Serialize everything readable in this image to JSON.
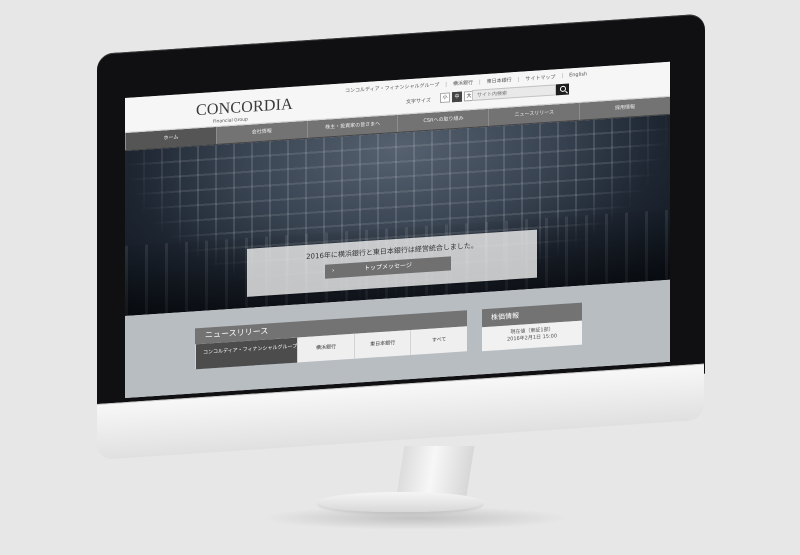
{
  "site": {
    "logo": "CONCORDIA",
    "logo_subtitle": "Financial Group",
    "utility_links": [
      "コンコルディア・フィナンシャルグループ",
      "横浜銀行",
      "東日本銀行",
      "サイトマップ",
      "English"
    ],
    "font_size_label": "文字サイズ",
    "font_sizes": [
      "小",
      "中",
      "大"
    ],
    "search_placeholder": "サイト内検索"
  },
  "navigation": {
    "items": [
      "ホーム",
      "会社情報",
      "株主・投資家の皆さまへ",
      "CSRへの取り組み",
      "ニュースリリース",
      "採用情報"
    ]
  },
  "hero": {
    "message": "2016年に横浜銀行と東日本銀行は経営統合しました。",
    "button_label": "トップメッセージ"
  },
  "news": {
    "title": "ニュースリリース",
    "tabs": [
      "コンコルディア・フィナンシャルグループ",
      "横浜銀行",
      "東日本銀行",
      "すべて"
    ]
  },
  "stock": {
    "title": "株価情報",
    "line1": "現在値（東証1部）",
    "line2": "2016年2月1日 15:00"
  },
  "colors": {
    "nav": "#737373",
    "active_nav": "#555555",
    "content_bg": "#b8bdc1"
  }
}
